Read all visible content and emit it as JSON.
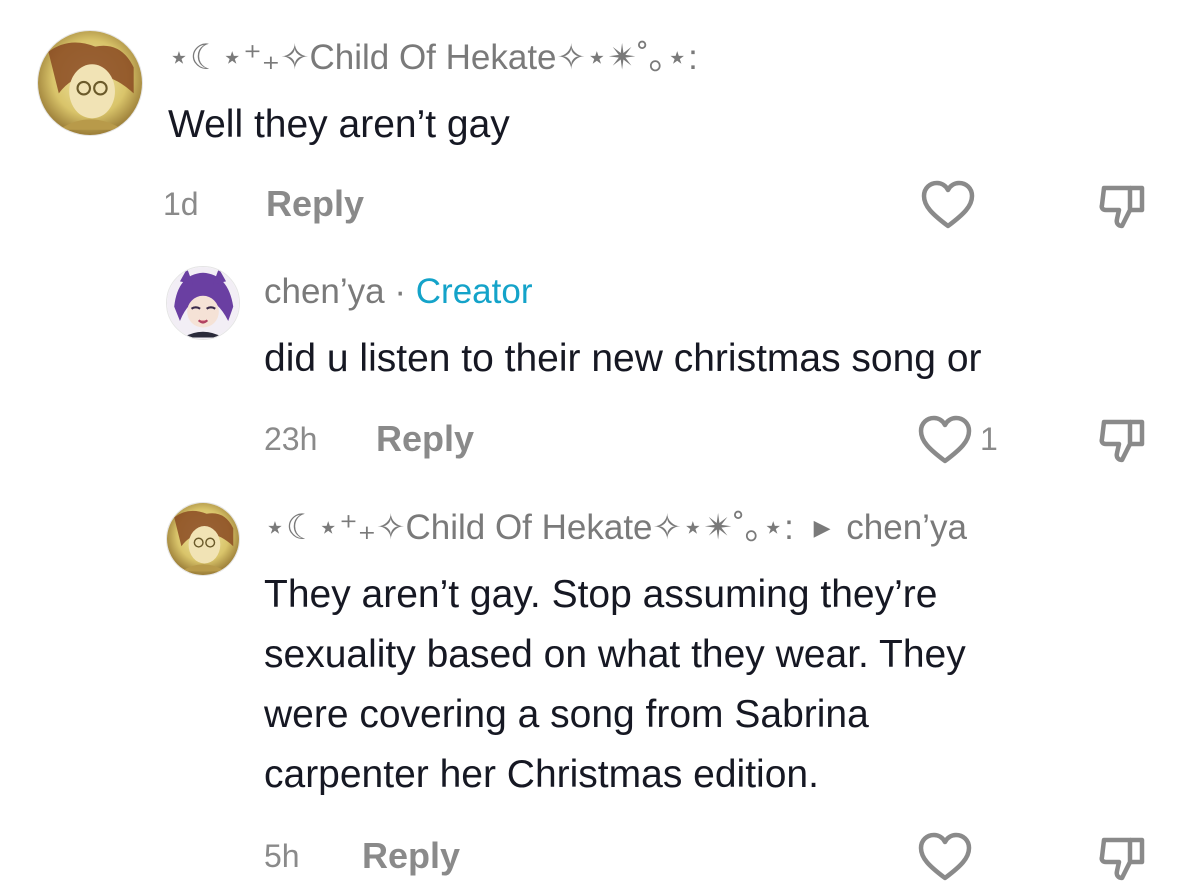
{
  "comments": [
    {
      "username": "⋆☾⋆⁺₊✧Child Of Hekate✧⋆✴︎˚｡⋆:",
      "text_lines": [
        "Well they aren’t gay"
      ],
      "time": "1d",
      "reply_label": "Reply",
      "like_count": "",
      "avatar_icon": "avatar-child-of-hekate",
      "like_icon": "heart-outline-icon",
      "dislike_icon": "thumbs-down-icon"
    },
    {
      "username": "chen’ya",
      "separator": "·",
      "badge": "Creator",
      "text_lines": [
        "did u listen to their new christmas song or"
      ],
      "time": "23h",
      "reply_label": "Reply",
      "like_count": "1",
      "avatar_icon": "avatar-chenya",
      "like_icon": "heart-outline-icon",
      "dislike_icon": "thumbs-down-icon"
    },
    {
      "username": "⋆☾⋆⁺₊✧Child Of Hekate✧⋆✴︎˚｡⋆:",
      "reply_to": "chen’ya",
      "text_lines": [
        "They aren’t gay. Stop assuming they’re",
        "sexuality based on what they wear. They",
        "were covering a song from Sabrina",
        "carpenter her Christmas edition."
      ],
      "time": "5h",
      "reply_label": "Reply",
      "like_count": "",
      "avatar_icon": "avatar-child-of-hekate",
      "like_icon": "heart-outline-icon",
      "dislike_icon": "thumbs-down-icon"
    }
  ],
  "colors": {
    "text": "#161823",
    "meta": "#8a8a8a",
    "username": "#7a7a7a",
    "creator_badge": "#14a3c9",
    "icon": "#8a8a8a"
  }
}
